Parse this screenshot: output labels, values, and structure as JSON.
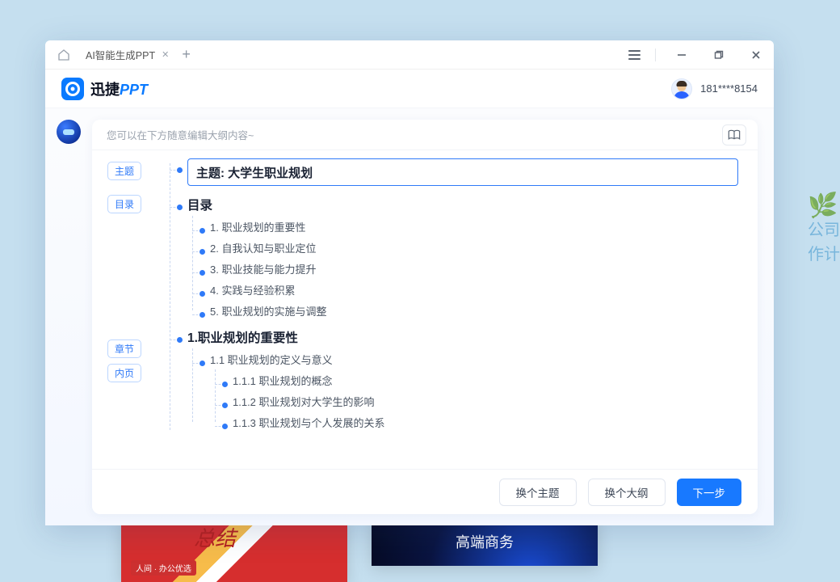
{
  "tab": {
    "title": "AI智能生成PPT"
  },
  "logo": {
    "text_a": "迅捷",
    "text_b": "PPT"
  },
  "user": {
    "phone": "181****8154"
  },
  "panel": {
    "hint": "您可以在下方随意编辑大纲内容~"
  },
  "gutter": {
    "topic": "主题",
    "toc": "目录",
    "chapter": "章节",
    "inner": "内页"
  },
  "outline": {
    "title": "主题: 大学生职业规划",
    "toc_label": "目录",
    "toc": [
      "1. 职业规划的重要性",
      "2. 自我认知与职业定位",
      "3. 职业技能与能力提升",
      "4. 实践与经验积累",
      "5. 职业规划的实施与调整"
    ],
    "chapter1": {
      "heading": "1.职业规划的重要性",
      "sec": "1.1 职业规划的定义与意义",
      "items": [
        "1.1.1 职业规划的概念",
        "1.1.2 职业规划对大学生的影响",
        "1.1.3 职业规划与个人发展的关系"
      ]
    }
  },
  "footer": {
    "change_topic": "换个主题",
    "change_outline": "换个大纲",
    "next": "下一步"
  },
  "bg": {
    "line1": "公司全",
    "line2": "作计划",
    "tile_blue": "高端商务"
  }
}
